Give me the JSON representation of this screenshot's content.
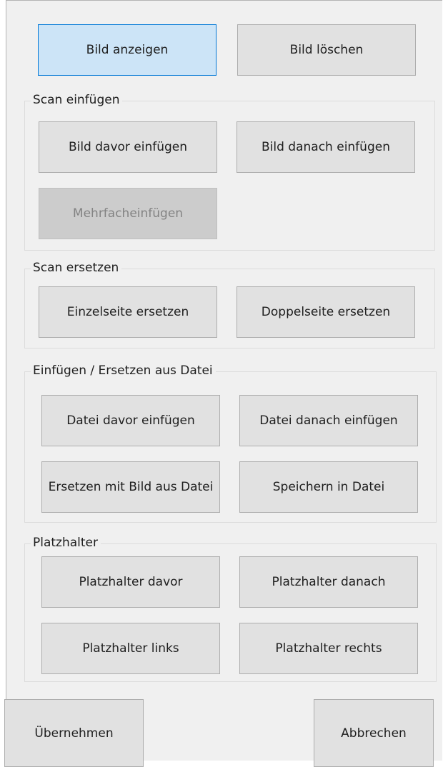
{
  "top_buttons": {
    "show_image": "Bild anzeigen",
    "delete_image": "Bild löschen"
  },
  "scan_insert": {
    "title": "Scan einfügen",
    "insert_before": "Bild davor einfügen",
    "insert_after": "Bild danach einfügen",
    "multi_insert": "Mehrfacheinfügen"
  },
  "scan_replace": {
    "title": "Scan ersetzen",
    "single_page": "Einzelseite ersetzen",
    "double_page": "Doppelseite ersetzen"
  },
  "file_ops": {
    "title": "Einfügen / Ersetzen aus Datei",
    "file_before": "Datei davor einfügen",
    "file_after": "Datei danach einfügen",
    "replace_from_file": "Ersetzen mit Bild aus Datei",
    "save_to_file": "Speichern in Datei"
  },
  "placeholder": {
    "title": "Platzhalter",
    "before": "Platzhalter davor",
    "after": "Platzhalter danach",
    "left": "Platzhalter links",
    "right": "Platzhalter rechts"
  },
  "footer": {
    "apply": "Übernehmen",
    "cancel": "Abbrechen"
  },
  "colors": {
    "panel_background": "#f0f0f0",
    "button_face": "#e1e1e1",
    "button_border": "#adadad",
    "focused_button_face": "#cce4f7",
    "focused_button_border": "#0078d7",
    "disabled_button_face": "#cccccc",
    "disabled_text": "#838383",
    "group_border": "#dcdcdc"
  }
}
